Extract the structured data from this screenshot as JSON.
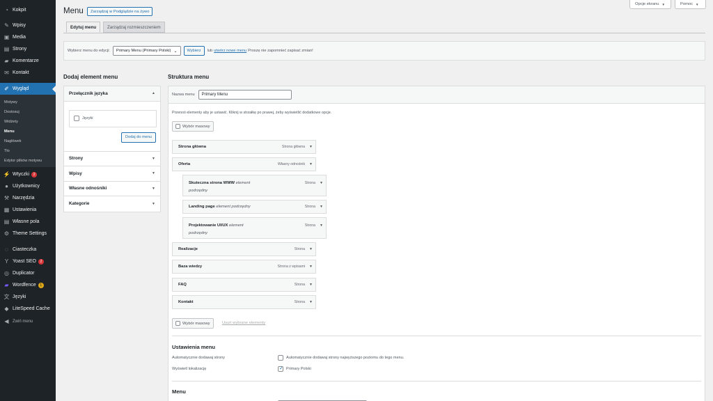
{
  "sidebar": {
    "dashboard": "Kokpit",
    "posts": "Wpisy",
    "media": "Media",
    "pages": "Strony",
    "comments": "Komentarze",
    "contact": "Kontakt",
    "appearance": "Wygląd",
    "submenu": [
      "Motywy",
      "Dostosuj",
      "Widżety",
      "Menu",
      "Nagłówek",
      "Tło",
      "Edytor plików motywu"
    ],
    "plugins": "Wtyczki",
    "plugins_badge": "2",
    "users": "Użytkownicy",
    "tools": "Narzędzia",
    "settings": "Ustawienia",
    "custom_fields": "Własne pola",
    "theme_settings": "Theme Settings",
    "cookies": "Ciasteczka",
    "yoast": "Yoast SEO",
    "yoast_badge": "2",
    "duplicator": "Duplicator",
    "wordfence": "Wordfence",
    "wordfence_badge": "1",
    "languages": "Języki",
    "litespeed": "LiteSpeed Cache",
    "collapse": "Zwiń menu"
  },
  "top": {
    "screen_options": "Opcje ekranu",
    "help": "Pomoc"
  },
  "header": {
    "title": "Menu",
    "live_preview": "Zarządzaj w Podglądzie na żywo"
  },
  "tabs": [
    "Edytuj menu",
    "Zarządzaj rozmieszczeniem"
  ],
  "select_bar": {
    "label": "Wybierz menu do edycji:",
    "selected": "Primary Menu (Primary Polski)",
    "button": "Wybierz",
    "or": "lub",
    "create_link": "utwórz nowe menu",
    "save_note": "Proszę nie zapomnieć zapisać zmian!"
  },
  "add_items": {
    "heading": "Dodaj element menu",
    "open_section": "Przełącznik języka",
    "checkbox_label": "Języki",
    "add_button": "Dodaj do menu",
    "sections": [
      "Strony",
      "Wpisy",
      "Własne odnośniki",
      "Kategorie"
    ]
  },
  "structure": {
    "heading": "Struktura menu",
    "name_label": "Nazwa menu",
    "name_value": "Primary Menu",
    "hint": "Przenoś elementy aby je ustawić. Kliknij w strzałkę po prawej, żeby wyświetlić dodatkowe opcje.",
    "bulk_select": "Wybór masowy",
    "remove_selected": "Usuń wybrane elementy",
    "items": [
      {
        "title": "Strona główna",
        "type": "Strona główna"
      },
      {
        "title": "Oferta",
        "type": "Własny odnośnik"
      },
      {
        "title": "Skuteczna strona WWW",
        "sub": "element",
        "sub2": "podrzędny",
        "type": "Strona"
      },
      {
        "title": "Landing page",
        "sub": "element podrzędny",
        "type": "Strona"
      },
      {
        "title": "Projektowanie UI/UX",
        "sub": "element",
        "sub2": "podrzędny",
        "type": "Strona"
      },
      {
        "title": "Realizacje",
        "type": "Strona"
      },
      {
        "title": "Baza wiedzy",
        "type": "Strona z wpisami"
      },
      {
        "title": "FAQ",
        "type": "Strona"
      },
      {
        "title": "Kontakt",
        "type": "Strona"
      }
    ]
  },
  "menu_settings": {
    "heading": "Ustawienia menu",
    "auto_add_label": "Automatycznie dodawaj strony",
    "auto_add_value": "Automatycznie dodawaj strony najwyższego poziomu do tego menu.",
    "location_label": "Wyświetl lokalizację",
    "location_value": "Primary Polski",
    "location_checked": true,
    "auto_add_checked": false
  },
  "menu_section": {
    "heading": "Menu"
  },
  "colors": {
    "sidebar_bg": "#1d2327",
    "accent": "#2271b1",
    "badge_red": "#d63638",
    "badge_yellow": "#dba617"
  }
}
